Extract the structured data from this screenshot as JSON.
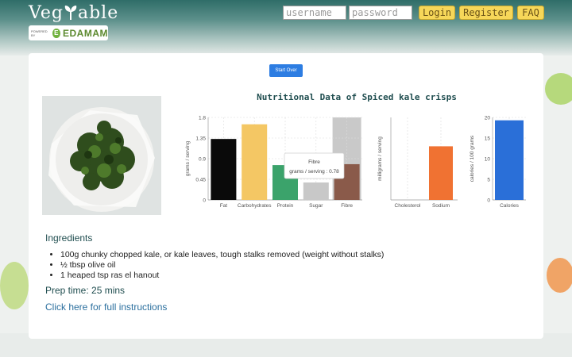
{
  "header": {
    "logo_text_left": "Veg",
    "logo_text_right": "able",
    "powered_by": "POWERED BY",
    "edamam_badge": "E",
    "edamam_word": "EDAMAM",
    "username_placeholder": "username",
    "password_placeholder": "password",
    "login_label": "Login",
    "register_label": "Register",
    "faq_label": "FAQ"
  },
  "main": {
    "start_over_label": "Start Over",
    "chart_title": "Nutritional Data of Spiced kale crisps"
  },
  "tooltip": {
    "title": "Fibre",
    "text": "grams / serving : 0.78"
  },
  "chart_data": [
    {
      "type": "bar",
      "ylabel": "grams / serving",
      "ylim": [
        0,
        1.8
      ],
      "yticks": [
        "0",
        "0.45",
        "0.9",
        "1.35",
        "1.8"
      ],
      "categories": [
        "Fat",
        "Carbohydrates",
        "Protein",
        "Sugar",
        "Fibre"
      ],
      "values": [
        1.33,
        1.65,
        0.76,
        0.38,
        0.78
      ],
      "colors": [
        "#0a0a0a",
        "#f4c764",
        "#3ba36b",
        "#c8c8c8",
        "#8a5a4a"
      ],
      "highlight_background": "Fibre",
      "grid": true
    },
    {
      "type": "bar",
      "ylabel": "milligrams / serving",
      "categories": [
        "Cholesterol",
        "Sodium"
      ],
      "values": [
        0,
        6.5
      ],
      "ylim": [
        0,
        10
      ],
      "colors": [
        "#2d7de2",
        "#f07232"
      ],
      "grid": true
    },
    {
      "type": "bar",
      "ylabel": "calories / 100 grams",
      "ylim": [
        0,
        20
      ],
      "yticks": [
        "0",
        "5",
        "10",
        "15",
        "20"
      ],
      "categories": [
        "Calories"
      ],
      "values": [
        19.3
      ],
      "colors": [
        "#2a6fd8"
      ],
      "grid": true
    }
  ],
  "recipe": {
    "ingredients_heading": "Ingredients",
    "ingredients": [
      "100g chunky chopped kale, or kale leaves, tough stalks removed (weight without stalks)",
      "½ tbsp olive oil",
      "1 heaped tsp ras el hanout"
    ],
    "prep_time": "Prep time: 25 mins",
    "full_instructions_link": "Click here for full instructions"
  }
}
